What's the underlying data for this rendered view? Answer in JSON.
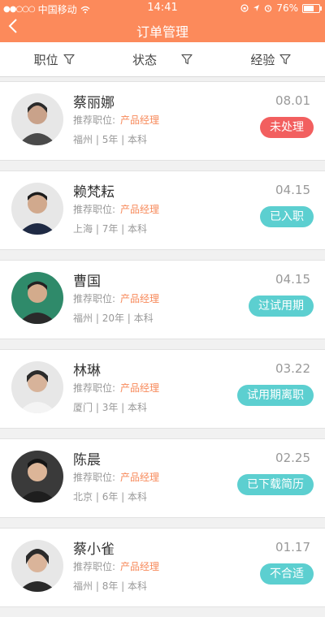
{
  "status_bar": {
    "carrier": "中国移动",
    "time": "14:41",
    "battery": "76%",
    "battery_level": 0.76
  },
  "header": {
    "title": "订单管理",
    "back_icon": "back-chevron-icon"
  },
  "filters": [
    {
      "label": "职位",
      "icon": "filter-icon"
    },
    {
      "label": "状态",
      "icon": "filter-icon"
    },
    {
      "label": "经验",
      "icon": "filter-icon"
    }
  ],
  "colors": {
    "primary": "#fc8a5b",
    "badge_red": "#f25f5f",
    "badge_teal": "#5ccfd0"
  },
  "list_item_label": "推荐职位:",
  "items": [
    {
      "name": "蔡丽娜",
      "position": "产品经理",
      "city": "福州",
      "experience": "5年",
      "education": "本科",
      "date": "08.01",
      "status": "未处理",
      "status_type": "red"
    },
    {
      "name": "赖梵耘",
      "position": "产品经理",
      "city": "上海",
      "experience": "7年",
      "education": "本科",
      "date": "04.15",
      "status": "已入职",
      "status_type": "teal"
    },
    {
      "name": "曹国",
      "position": "产品经理",
      "city": "福州",
      "experience": "20年",
      "education": "本科",
      "date": "04.15",
      "status": "过试用期",
      "status_type": "teal"
    },
    {
      "name": "林琳",
      "position": "产品经理",
      "city": "厦门",
      "experience": "3年",
      "education": "本科",
      "date": "03.22",
      "status": "试用期离职",
      "status_type": "teal"
    },
    {
      "name": "陈晨",
      "position": "产品经理",
      "city": "北京",
      "experience": "6年",
      "education": "本科",
      "date": "02.25",
      "status": "已下载简历",
      "status_type": "teal"
    },
    {
      "name": "蔡小雀",
      "position": "产品经理",
      "city": "福州",
      "experience": "8年",
      "education": "本科",
      "date": "01.17",
      "status": "不合适",
      "status_type": "teal"
    }
  ]
}
